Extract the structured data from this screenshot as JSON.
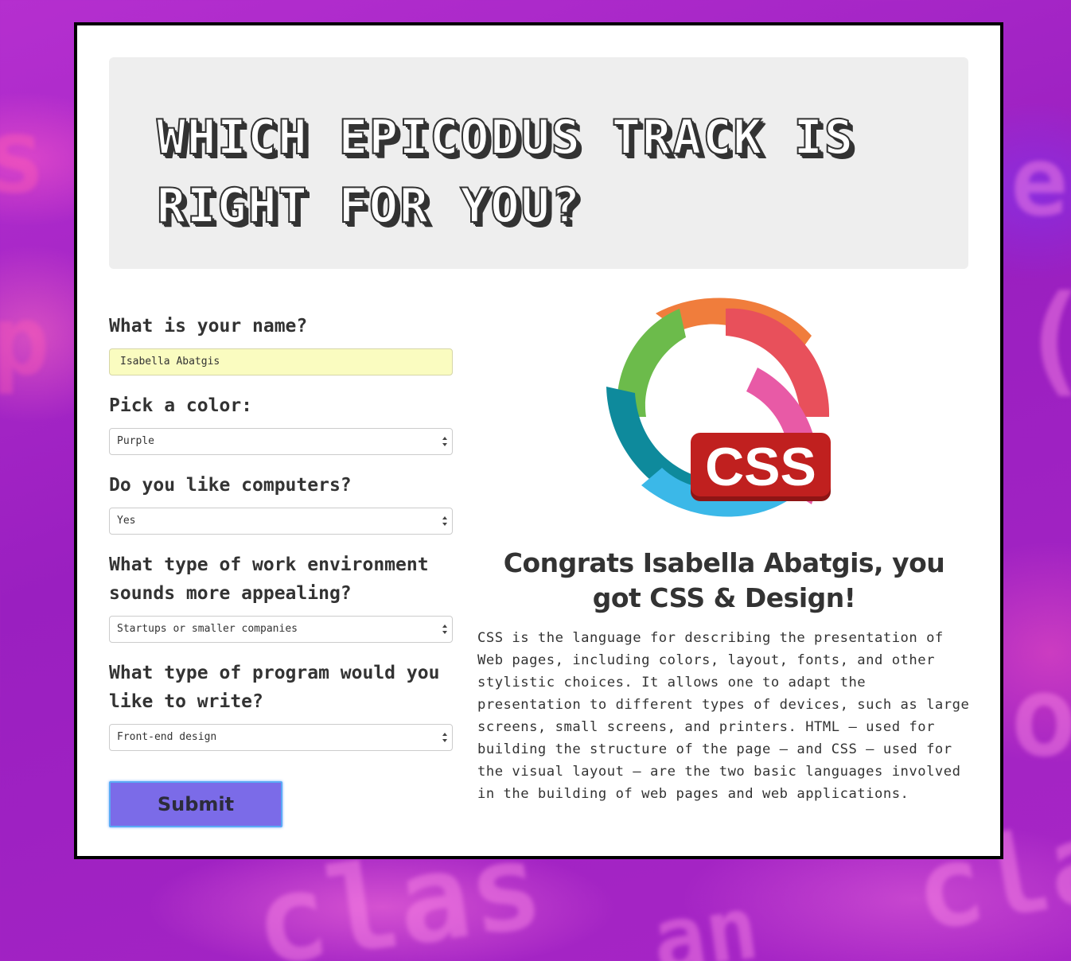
{
  "page": {
    "title": "Which Epicodus track is right for you?"
  },
  "form": {
    "name_question": "What is your name?",
    "name_value": "Isabella Abatgis",
    "color_question": "Pick a color:",
    "color_value": "Purple",
    "computers_question": "Do you like computers?",
    "computers_value": "Yes",
    "environment_question": "What type of work environment sounds more appealing?",
    "environment_value": "Startups or smaller companies",
    "program_question": "What type of program would you like to write?",
    "program_value": "Front-end design",
    "submit_label": "Submit"
  },
  "result": {
    "logo_text": "CSS",
    "title": "Congrats Isabella Abatgis, you got CSS & Design!",
    "description": "CSS is the language for describing the presentation of Web pages, including colors, layout, fonts, and other stylistic choices. It allows one to adapt the presentation to different types of devices, such as large screens, small screens, and printers. HTML — used for building the structure of the page — and CSS — used for the visual layout — are the two basic languages involved in the building of web pages and web applications."
  },
  "colors": {
    "background": "#a020c0",
    "card_border": "#000000",
    "jumbotron_bg": "#eeeeee",
    "name_input_bg": "#fafcc0",
    "submit_bg": "#7b6be8",
    "logo_red": "#c0201f"
  }
}
